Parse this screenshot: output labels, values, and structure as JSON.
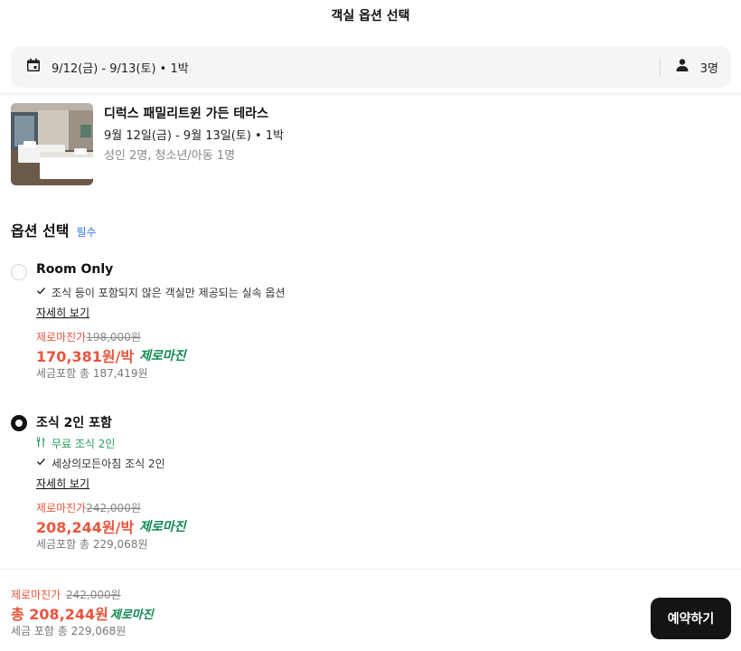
{
  "header": {
    "title": "객실 옵션 선택"
  },
  "search": {
    "dates": "9/12(금) - 9/13(토)  •  1박",
    "guests": "3명"
  },
  "room": {
    "name": "디럭스 패밀리트윈 가든 테라스",
    "dates": "9월 12일(금) - 9월 13일(토) • 1박",
    "guests": "성인 2명, 청소년/아동 1명"
  },
  "options_section": {
    "title": "옵션 선택",
    "required": "필수"
  },
  "options": [
    {
      "name": "Room Only",
      "selected": false,
      "perk": "",
      "feature": "조식 등이 포함되지 않은 객실만 제공되는 실속 옵션",
      "detail_link": "자세히 보기",
      "zero_margin_label": "제로마진가",
      "original_price": "198,000원",
      "price": "170,381원/박",
      "zero_margin_badge": "제로마진",
      "tax_included": "세금포함 총 187,419원"
    },
    {
      "name": "조식 2인 포함",
      "selected": true,
      "perk": "무료 조식 2인",
      "feature": "세상의모든아침 조식 2인",
      "detail_link": "자세히 보기",
      "zero_margin_label": "제로마진가",
      "original_price": "242,000원",
      "price": "208,244원/박",
      "zero_margin_badge": "제로마진",
      "tax_included": "세금포함 총 229,068원"
    }
  ],
  "footer": {
    "zero_margin_label": "제로마진가",
    "original_price": "242,000원",
    "total": "총 208,244원",
    "zero_margin_badge": "제로마진",
    "tax_included": "세금 포함 총 229,068원",
    "reserve_button": "예약하기"
  },
  "colors": {
    "accent_red": "#e8553e",
    "zero_margin_green": "#128a52",
    "required_blue": "#2c7be5",
    "button_dark": "#141414"
  },
  "icons": {
    "calendar": "calendar-icon",
    "person": "person-icon",
    "check": "check-icon",
    "utensils": "utensils-icon"
  }
}
